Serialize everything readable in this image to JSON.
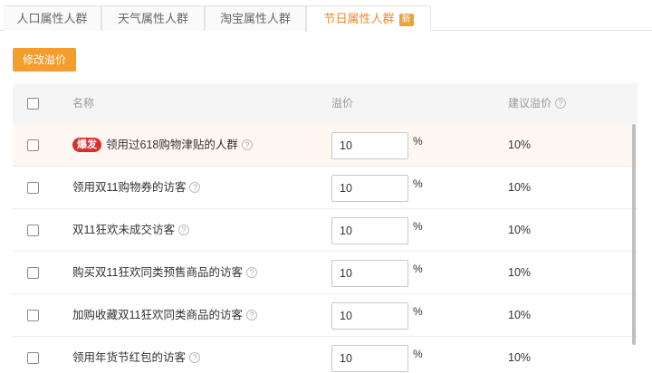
{
  "tabs": [
    {
      "label": "人口属性人群"
    },
    {
      "label": "天气属性人群"
    },
    {
      "label": "淘宝属性人群"
    },
    {
      "label": "节日属性人群",
      "badge": "新",
      "active": true
    }
  ],
  "toolbar": {
    "edit_label": "修改溢价"
  },
  "table": {
    "headers": {
      "name": "名称",
      "price": "溢价",
      "suggest": "建议溢价"
    },
    "rows": [
      {
        "hot": "爆发",
        "name": "领用过618购物津贴的人群",
        "value": "10",
        "unit": "%",
        "suggest": "10%"
      },
      {
        "name": "领用双11购物券的访客",
        "value": "10",
        "unit": "%",
        "suggest": "10%"
      },
      {
        "name": "双11狂欢未成交访客",
        "value": "10",
        "unit": "%",
        "suggest": "10%"
      },
      {
        "name": "购买双11狂欢同类预售商品的访客",
        "value": "10",
        "unit": "%",
        "suggest": "10%"
      },
      {
        "name": "加购收藏双11狂欢同类商品的访客",
        "value": "10",
        "unit": "%",
        "suggest": "10%"
      },
      {
        "name": "领用年货节红包的访客",
        "value": "10",
        "unit": "%",
        "suggest": "10%"
      }
    ]
  },
  "colors": {
    "accent": "#f49c2c",
    "hot_badge": "#d9302a",
    "new_badge": "#e8a33a"
  },
  "icons": {
    "help": "question-circle-icon"
  }
}
